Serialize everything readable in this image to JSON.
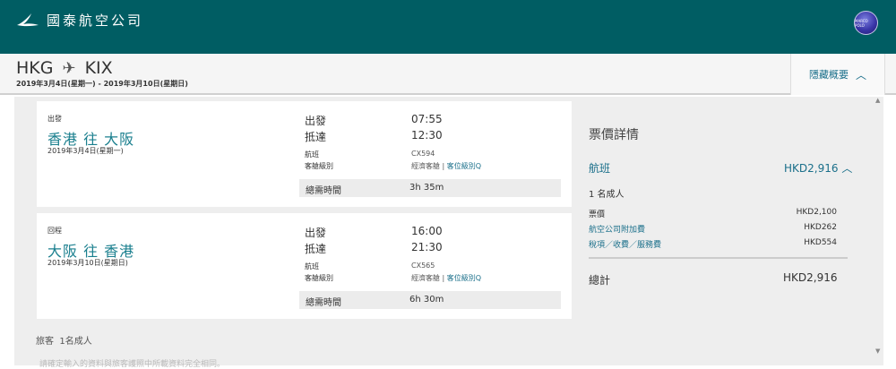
{
  "header": {
    "airline_name": "國泰航空公司",
    "logo_icon": "brushwing-logo",
    "member_badge_text": "MARCO POLO"
  },
  "route_bar": {
    "origin": "HKG",
    "destination": "KIX",
    "dates": "2019年3月4日(星期一) - 2019年3月10日(星期日)",
    "hide_summary_label": "隱藏概要"
  },
  "outbound": {
    "direction_label": "出發",
    "city_pair": "香港 往 大阪",
    "date": "2019年3月4日(星期一)",
    "depart_label": "出發",
    "depart_time": "07:55",
    "arrive_label": "抵達",
    "arrive_time": "12:30",
    "flight_label": "航班",
    "flight_no": "CX594",
    "cabin_label": "客艙級別",
    "cabin_value": "經濟客艙 |",
    "fare_class_link": "客位級別Q",
    "duration_label": "總需時間",
    "duration": "3h 35m"
  },
  "inbound": {
    "direction_label": "回程",
    "city_pair": "大阪 往 香港",
    "date": "2019年3月10日(星期日)",
    "depart_label": "出發",
    "depart_time": "16:00",
    "arrive_label": "抵達",
    "arrive_time": "21:30",
    "flight_label": "航班",
    "flight_no": "CX565",
    "cabin_label": "客艙級別",
    "cabin_value": "經濟客艙 |",
    "fare_class_link": "客位級別Q",
    "duration_label": "總需時間",
    "duration": "6h 30m"
  },
  "travellers": {
    "label": "旅客",
    "value": "1名成人"
  },
  "footnote": "請確定輸入的資料與旅客護照中所載資料完全相同。",
  "fare": {
    "title": "票價詳情",
    "flight_label": "航班",
    "flight_amount": "HKD2,916",
    "pax": "1 名成人",
    "rows": [
      {
        "label": "票價",
        "amount": "HKD2,100"
      },
      {
        "label": "航空公司附加費",
        "amount": "HKD262"
      },
      {
        "label": "稅項／收費／服務費",
        "amount": "HKD554"
      }
    ],
    "total_label": "總計",
    "total_amount": "HKD2,916"
  },
  "colors": {
    "header_bg": "#005d63",
    "link": "#1a6f8a",
    "city": "#1a7f8e"
  }
}
